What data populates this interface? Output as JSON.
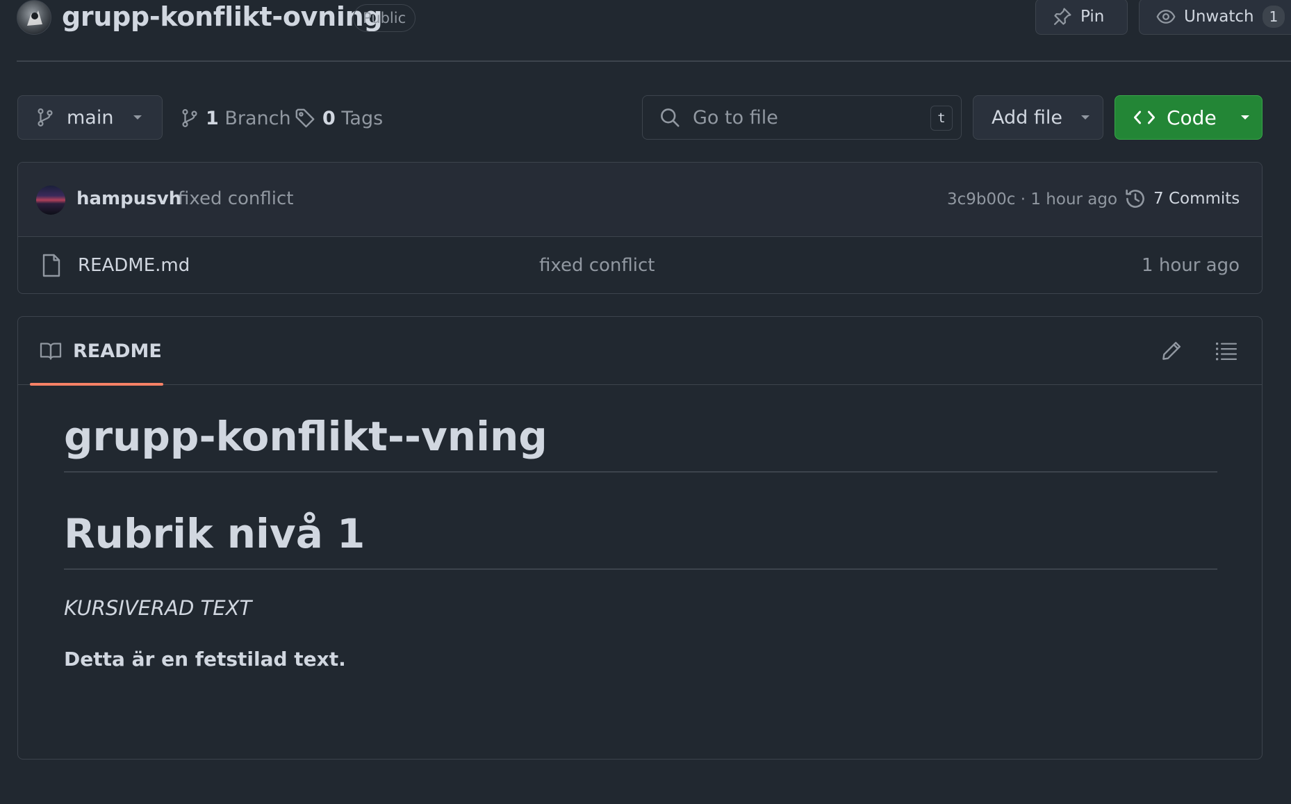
{
  "header": {
    "repo_name": "grupp-konflikt-ovning",
    "visibility": "Public",
    "pin_label": "Pin",
    "watch_label": "Unwatch",
    "watch_count": "1"
  },
  "toolbar": {
    "branch": "main",
    "branch_count": "1",
    "branch_label": "Branch",
    "tag_count": "0",
    "tag_label": "Tags",
    "goto_placeholder": "Go to file",
    "goto_shortcut": "t",
    "add_file_label": "Add file",
    "code_label": "Code"
  },
  "latest_commit": {
    "author": "hampusvh",
    "message": "fixed conflict",
    "meta": "3c9b00c · 1 hour ago",
    "commits_label": "7 Commits"
  },
  "files": [
    {
      "name": "README.md",
      "commit_message": "fixed conflict",
      "age": "1 hour ago"
    }
  ],
  "readme": {
    "tab_label": "README",
    "h1": "grupp-konflikt--vning",
    "h1_second": "Rubrik nivå 1",
    "italic_text": "KURSIVERAD TEXT",
    "bold_text": "Detta är en fetstilad text."
  },
  "colors": {
    "background": "#212830",
    "border": "#3d444d",
    "code_button": "#238636",
    "tab_underline": "#f78166"
  }
}
